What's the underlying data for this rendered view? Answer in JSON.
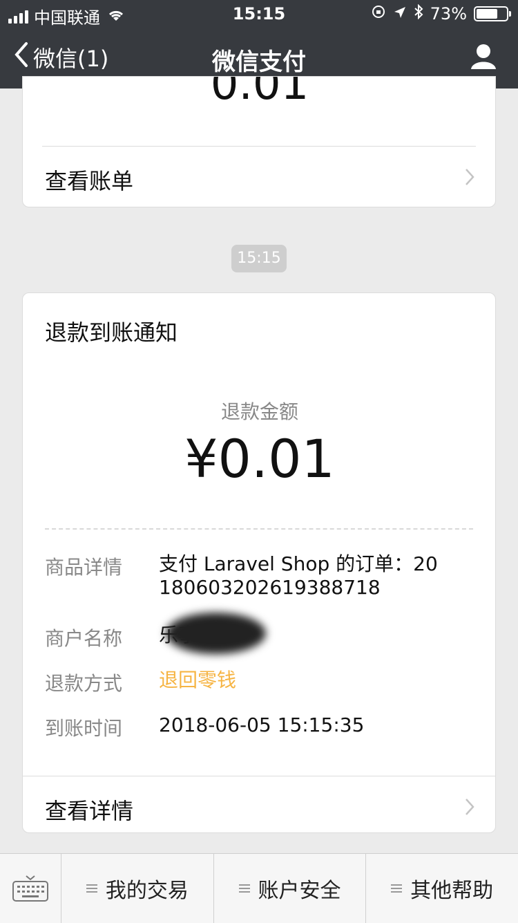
{
  "status": {
    "carrier": "中国联通",
    "time": "15:15",
    "battery": "73%",
    "battery_level": 0.73
  },
  "nav": {
    "back_label": "微信(1)",
    "title": "微信支付"
  },
  "card_prev": {
    "partial_amount": "0.01",
    "link_label": "查看账单"
  },
  "timestamp": "15:15",
  "refund": {
    "heading": "退款到账通知",
    "amount_label": "退款金额",
    "amount": "¥0.01",
    "details": [
      {
        "key": "商品详情",
        "value": "支付 Laravel Shop 的订单：20180603202619388718"
      },
      {
        "key": "商户名称",
        "value": "乐事"
      },
      {
        "key": "退款方式",
        "value": "退回零钱"
      },
      {
        "key": "到账时间",
        "value": "2018-06-05 15:15:35"
      }
    ],
    "link_label": "查看详情"
  },
  "toolbar": {
    "items": [
      "我的交易",
      "账户安全",
      "其他帮助"
    ]
  },
  "colors": {
    "nav_bg": "#373a3f",
    "accent_orange": "#f6b443"
  }
}
